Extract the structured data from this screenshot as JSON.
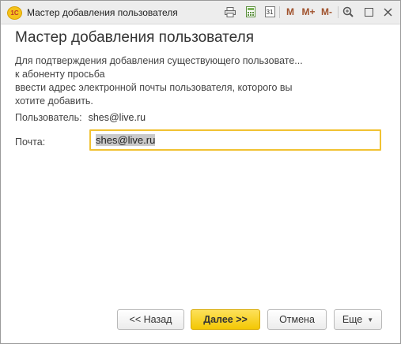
{
  "window": {
    "title": "Мастер добавления пользователя",
    "logo_text": "1С",
    "toolbar": {
      "mem_m": "M",
      "mem_mplus": "M+",
      "mem_mminus": "M-",
      "calendar_day": "31"
    }
  },
  "form": {
    "heading": "Мастер добавления пользователя",
    "description_lines": [
      "Для подтверждения добавления существующего пользовате...",
      "к абоненту просьба",
      "ввести адрес электронной почты пользователя, которого вы",
      "хотите добавить."
    ],
    "user_label": "Пользователь:",
    "user_value": "shes@live.ru",
    "mail_label": "Почта:",
    "mail_value": "shes@live.ru"
  },
  "buttons": {
    "back": "<< Назад",
    "next": "Далее >>",
    "cancel": "Отмена",
    "more": "Еще"
  },
  "colors": {
    "primary_button": "#f3c704",
    "input_focus_border": "#f1c232"
  }
}
